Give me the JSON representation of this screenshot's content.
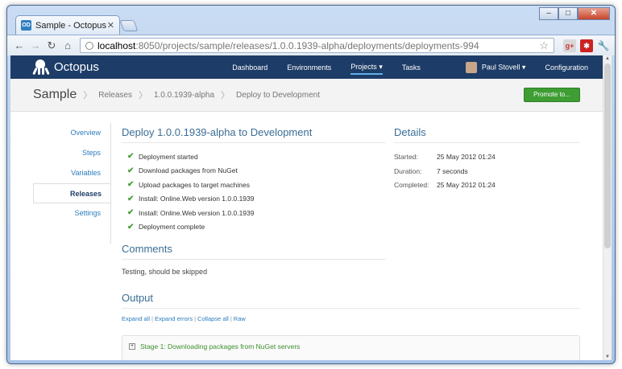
{
  "browser": {
    "tab_title": "Sample - Octopus",
    "tab_favicon": "OD",
    "url_host": "localhost",
    "url_path": ":8050/projects/sample/releases/1.0.0.1939-alpha/deployments/deployments-994",
    "icons": [
      "back-icon",
      "forward-icon",
      "reload-icon",
      "home-icon",
      "star-icon",
      "wrench-icon"
    ]
  },
  "app": {
    "logo": "Octopus",
    "nav": {
      "dashboard": "Dashboard",
      "environments": "Environments",
      "projects": "Projects",
      "tasks": "Tasks",
      "user": "Paul Stovell",
      "configuration": "Configuration"
    },
    "breadcrumb": {
      "project": "Sample",
      "releases": "Releases",
      "release": "1.0.0.1939-alpha",
      "current": "Deploy to Development"
    },
    "promote_label": "Promote to...",
    "sidenav": [
      "Overview",
      "Steps",
      "Variables",
      "Releases",
      "Settings"
    ],
    "deployment": {
      "title": "Deploy 1.0.0.1939-alpha to Development",
      "tasks": [
        "Deployment started",
        "Download packages from NuGet",
        "Upload packages to target machines",
        "Install: Online.Web version 1.0.0.1939",
        "Install: Online.Web version 1.0.0.1939",
        "Deployment complete"
      ]
    },
    "details": {
      "title": "Details",
      "rows": [
        {
          "label": "Started:",
          "value": "25 May 2012 01:24"
        },
        {
          "label": "Duration:",
          "value": "7 seconds"
        },
        {
          "label": "Completed:",
          "value": "25 May 2012 01:24"
        }
      ]
    },
    "comments": {
      "title": "Comments",
      "text": "Testing, should be skipped"
    },
    "output": {
      "title": "Output",
      "links": [
        "Expand all",
        "Expand errors",
        "Collapse all",
        "Raw"
      ],
      "stage": "Stage 1: Downloading packages from NuGet servers"
    }
  }
}
